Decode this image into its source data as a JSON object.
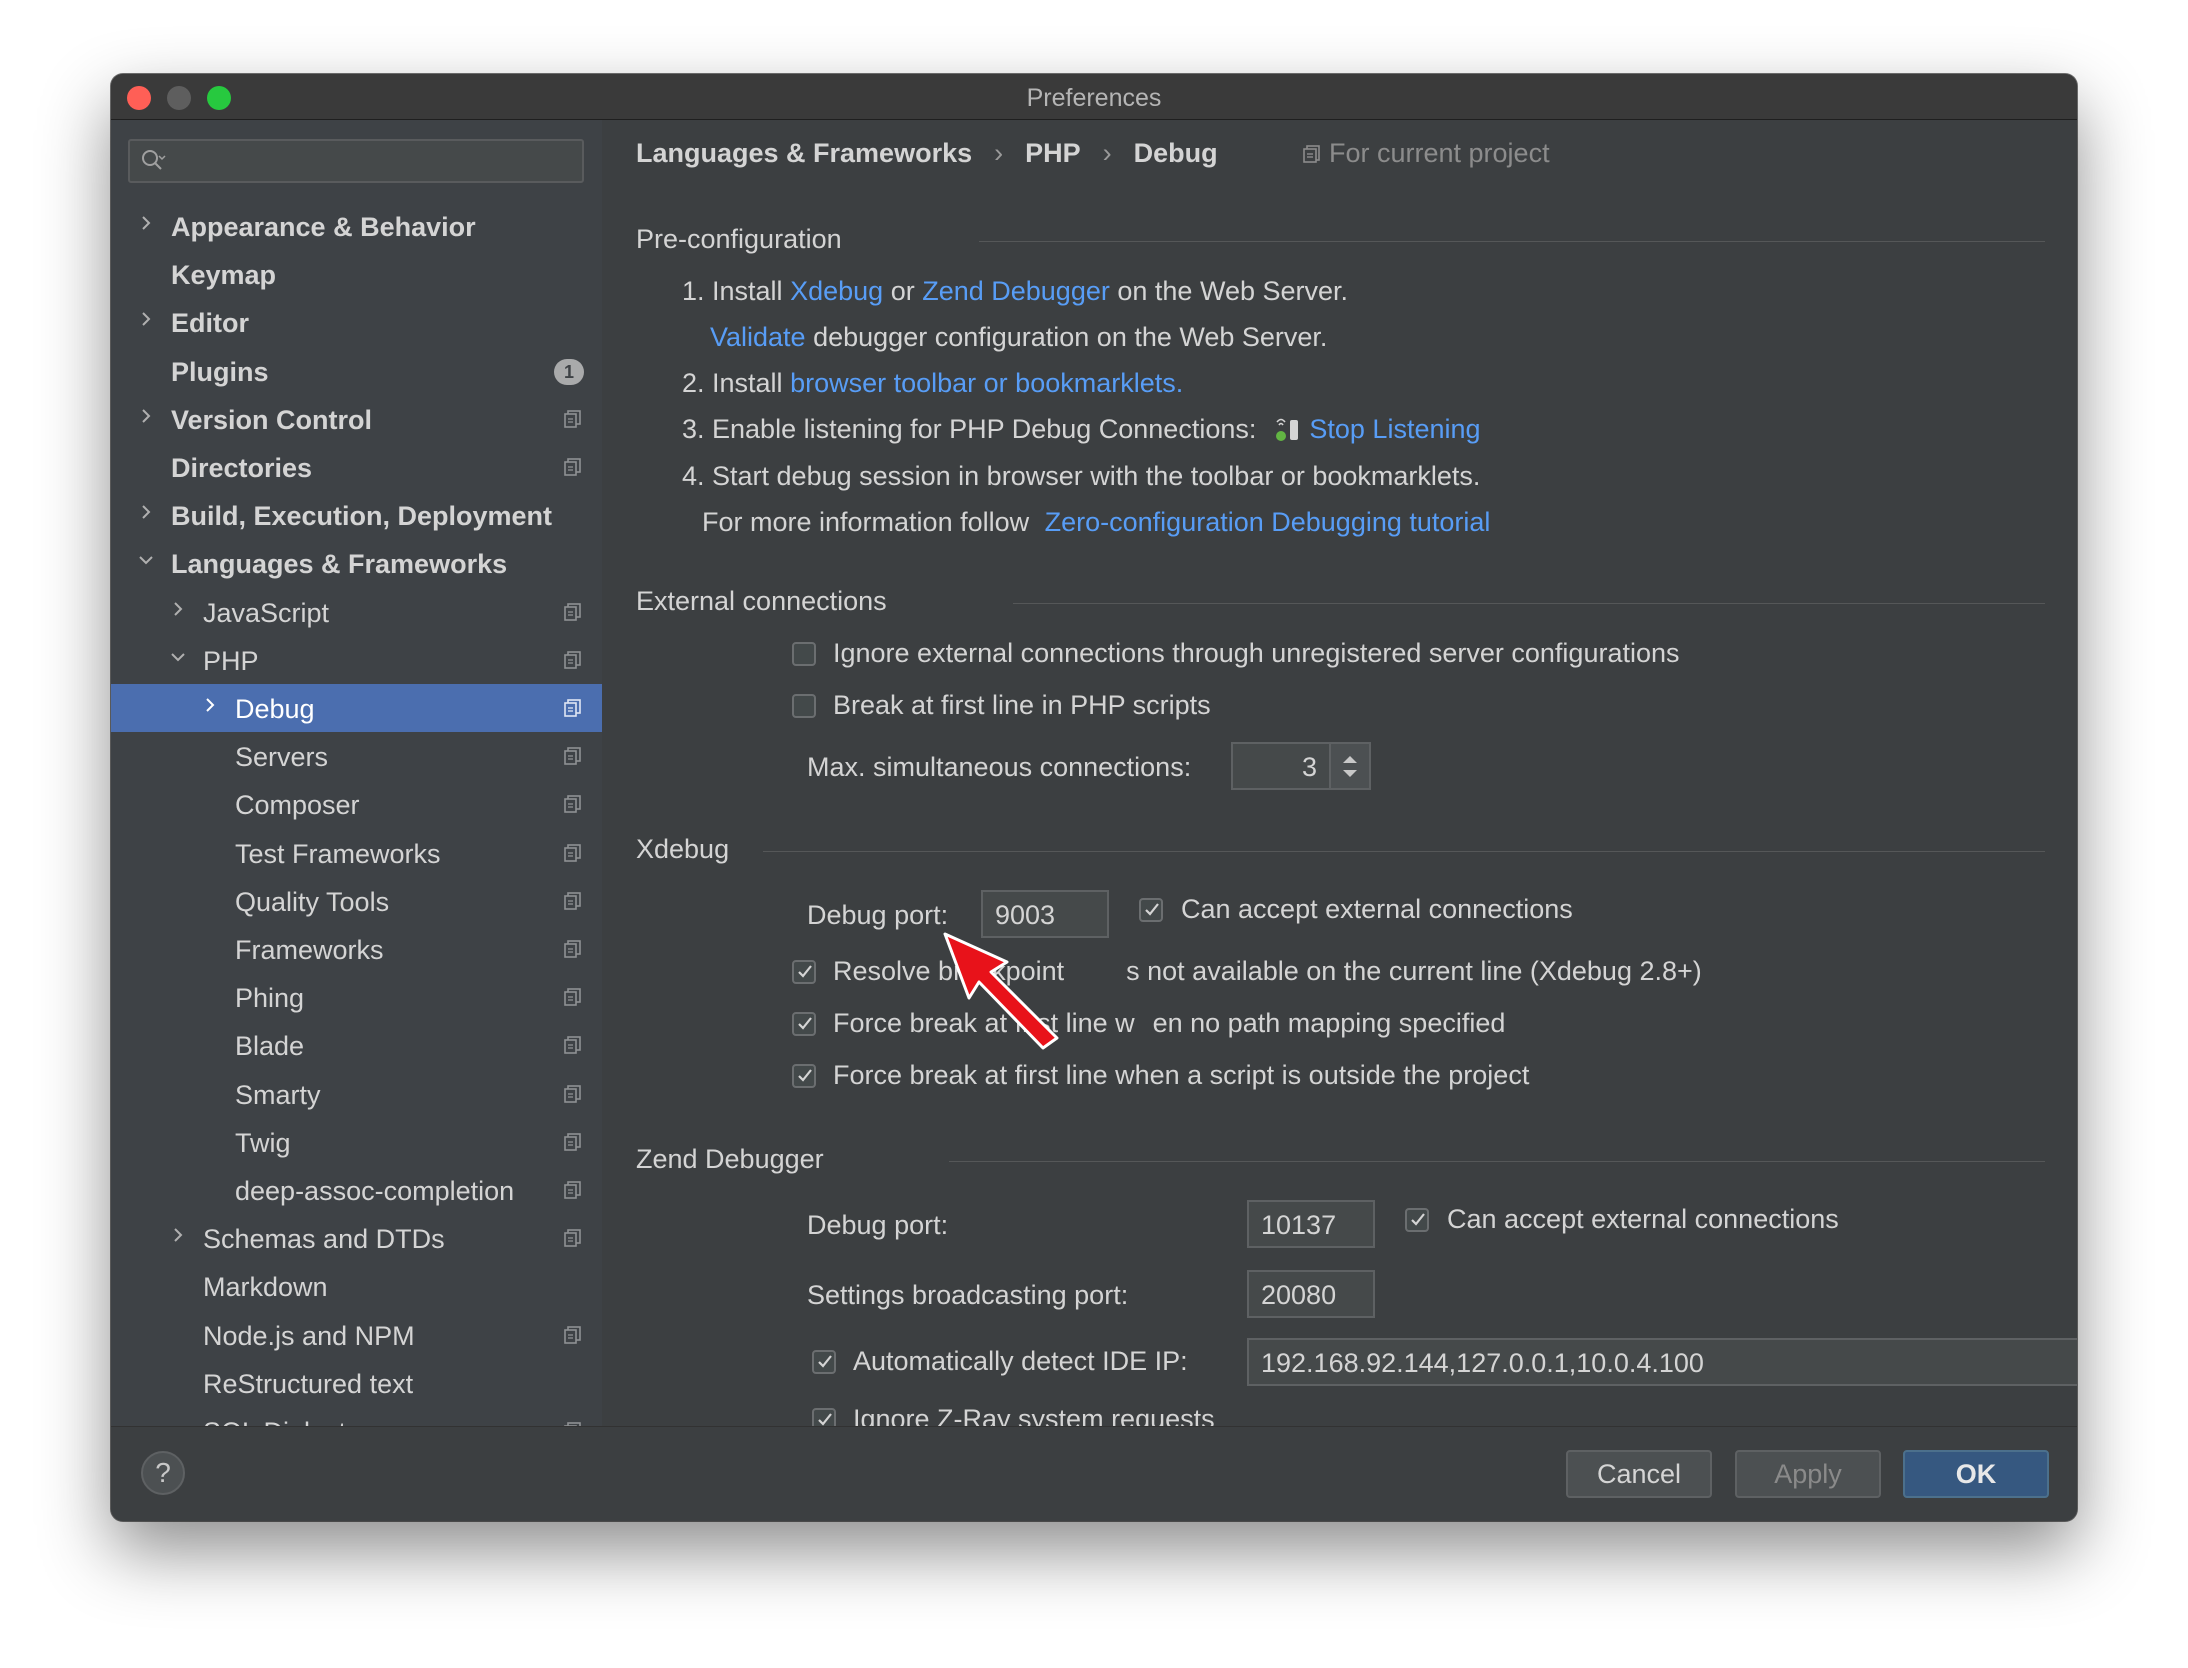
{
  "window": {
    "title": "Preferences"
  },
  "search": {
    "placeholder": ""
  },
  "sidebar": {
    "items": [
      {
        "label": "Appearance & Behavior",
        "chevron": "right",
        "bold": true
      },
      {
        "label": "Keymap",
        "bold": true
      },
      {
        "label": "Editor",
        "chevron": "right",
        "bold": true
      },
      {
        "label": "Plugins",
        "bold": true,
        "badge": "1"
      },
      {
        "label": "Version Control",
        "chevron": "right",
        "bold": true
      },
      {
        "label": "Directories",
        "bold": true
      },
      {
        "label": "Build, Execution, Deployment",
        "chevron": "right",
        "bold": true
      },
      {
        "label": "Languages & Frameworks",
        "chevron": "down",
        "bold": true
      },
      {
        "label": "JavaScript",
        "chevron": "right"
      },
      {
        "label": "PHP",
        "chevron": "down"
      },
      {
        "label": "Debug",
        "chevron": "right",
        "selected": true
      },
      {
        "label": "Servers"
      },
      {
        "label": "Composer"
      },
      {
        "label": "Test Frameworks"
      },
      {
        "label": "Quality Tools"
      },
      {
        "label": "Frameworks"
      },
      {
        "label": "Phing"
      },
      {
        "label": "Blade"
      },
      {
        "label": "Smarty"
      },
      {
        "label": "Twig"
      },
      {
        "label": "deep-assoc-completion"
      },
      {
        "label": "Schemas and DTDs",
        "chevron": "right"
      },
      {
        "label": "Markdown"
      },
      {
        "label": "Node.js and NPM"
      },
      {
        "label": "ReStructured text"
      },
      {
        "label": "SQL Dialects"
      }
    ]
  },
  "breadcrumb": {
    "items": [
      "Languages & Frameworks",
      "PHP",
      "Debug"
    ],
    "separator": "›",
    "scope": "For current project"
  },
  "preconfig": {
    "title": "Pre-configuration",
    "step1_prefix": "1. Install",
    "xdebug_link": "Xdebug",
    "or": "or",
    "zend_link": "Zend Debugger",
    "step1_suffix": "on the Web Server.",
    "validate_link": "Validate",
    "validate_suffix": "debugger configuration on the Web Server.",
    "step2_prefix": "2. Install",
    "toolbar_link": "browser toolbar or bookmarklets.",
    "step3": "3. Enable listening for PHP Debug Connections:",
    "stop_listening_link": "Stop Listening",
    "step4": "4. Start debug session in browser with the toolbar or bookmarklets.",
    "more_info": "For more information follow",
    "tutorial_link": "Zero-configuration Debugging tutorial"
  },
  "external": {
    "title": "External connections",
    "ignore_label": "Ignore external connections through unregistered server configurations",
    "ignore_checked": false,
    "break_label": "Break at first line in PHP scripts",
    "break_checked": false,
    "max_label": "Max. simultaneous connections:",
    "max_value": "3"
  },
  "xdebug": {
    "title": "Xdebug",
    "port_label": "Debug port:",
    "port_value": "9003",
    "accept_label": "Can accept external connections",
    "resolve_label_a": "Resolve breakpoint",
    "resolve_label_b": "s not available on the current line (Xdebug 2.8+)",
    "force1_label_a": "Force break at first line w",
    "force1_label_b": "en no path mapping specified",
    "force2_label": "Force break at first line when a script is outside the project"
  },
  "zend": {
    "title": "Zend Debugger",
    "port_label": "Debug port:",
    "port_value": "10137",
    "accept_label": "Can accept external connections",
    "broadcast_label": "Settings broadcasting port:",
    "broadcast_value": "20080",
    "detect_label": "Automatically detect IDE IP:",
    "detect_value": "192.168.92.144,127.0.0.1,10.0.4.100",
    "ignore_zray_label": "Ignore Z-Ray system requests"
  },
  "footer": {
    "help": "?",
    "cancel": "Cancel",
    "apply": "Apply",
    "ok": "OK"
  },
  "colors": {
    "link": "#589df6",
    "selection": "#4b6eaf",
    "arrow": "#e8121a"
  }
}
